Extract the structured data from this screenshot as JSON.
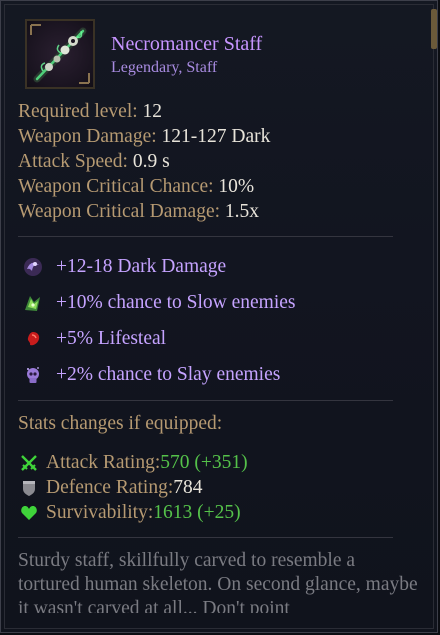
{
  "item": {
    "name": "Necromancer Staff",
    "subtitle": "Legendary, Staff",
    "icon": "necromancer-staff-icon"
  },
  "base_stats": [
    {
      "label": "Required level: ",
      "value": "12"
    },
    {
      "label": "Weapon Damage: ",
      "value": "121-127 Dark"
    },
    {
      "label": "Attack Speed: ",
      "value": "0.9 s"
    },
    {
      "label": "Weapon Critical Chance: ",
      "value": "10%"
    },
    {
      "label": "Weapon Critical Damage: ",
      "value": "1.5x"
    }
  ],
  "affixes": [
    {
      "icon": "dark-damage-icon",
      "text": "+12-18 Dark Damage"
    },
    {
      "icon": "slow-icon",
      "text": "+10% chance to Slow enemies"
    },
    {
      "icon": "lifesteal-icon",
      "text": "+5% Lifesteal"
    },
    {
      "icon": "slay-icon",
      "text": "+2% chance to Slay enemies"
    }
  ],
  "stat_changes": {
    "title": "Stats changes if equipped:",
    "items": [
      {
        "icon": "crossed-swords-icon",
        "label": "Attack Rating: ",
        "value": "570 (+351)",
        "trend": "up"
      },
      {
        "icon": "shield-icon",
        "label": "Defence Rating: ",
        "value": "784",
        "trend": "none"
      },
      {
        "icon": "heart-icon",
        "label": "Survivability: ",
        "value": "1613 (+25)",
        "trend": "up"
      }
    ]
  },
  "flavor_text": "Sturdy staff, skillfully carved to resemble a tortured human skeleton. On second glance, maybe it wasn't carved at all... Don't point",
  "colors": {
    "legendary": "#c795ff",
    "affix": "#c5a3ff",
    "label": "#b69a72",
    "value": "#e8e4da",
    "positive": "#55c24a",
    "flavor": "#7a7b82"
  }
}
